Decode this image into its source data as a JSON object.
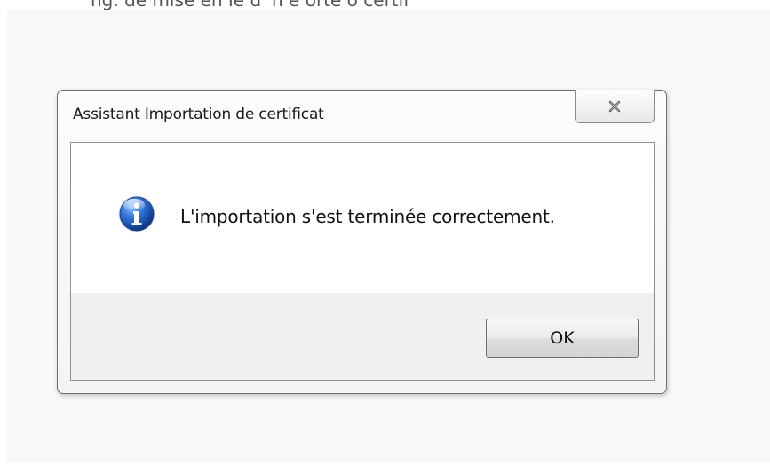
{
  "page": {
    "top_caption": "ng. de mise en   Ie d' n  e orte o  certif"
  },
  "dialog": {
    "title": "Assistant Importation de certificat",
    "close_icon": "close-x-icon",
    "message_icon": "information-icon",
    "message": "L'importation s'est terminée correctement.",
    "ok_label": "OK"
  },
  "colors": {
    "info_icon_blue": "#1f5fc4",
    "footer_gray": "#f0f0f0",
    "window_border": "#6e6e6e"
  }
}
